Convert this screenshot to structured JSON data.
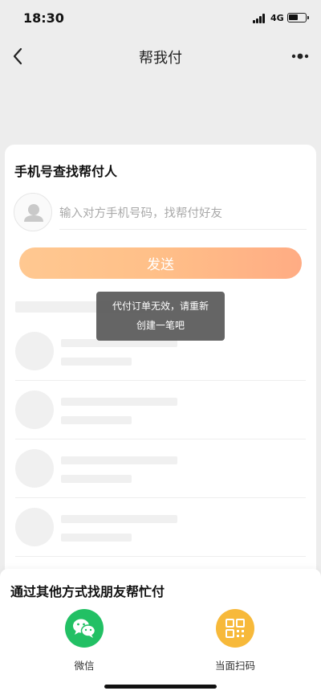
{
  "status_bar": {
    "time": "18:30",
    "network": "4G",
    "battery_level": 0.55
  },
  "nav": {
    "title": "帮我付"
  },
  "main": {
    "section_title": "手机号查找帮付人",
    "phone_placeholder": "输入对方手机号码，找帮付好友",
    "phone_value": "",
    "send_label": "发送"
  },
  "toast": {
    "line1": "代付订单无效，请重新",
    "line2": "创建一笔吧"
  },
  "other": {
    "title": "通过其他方式找朋友帮忙付",
    "options": [
      {
        "label": "微信",
        "icon": "wechat-icon",
        "color": "#22c064"
      },
      {
        "label": "当面扫码",
        "icon": "qr-code-icon",
        "color": "#f7b93a"
      }
    ]
  },
  "colors": {
    "accent_start": "#ffc891",
    "accent_end": "#ffac84"
  }
}
